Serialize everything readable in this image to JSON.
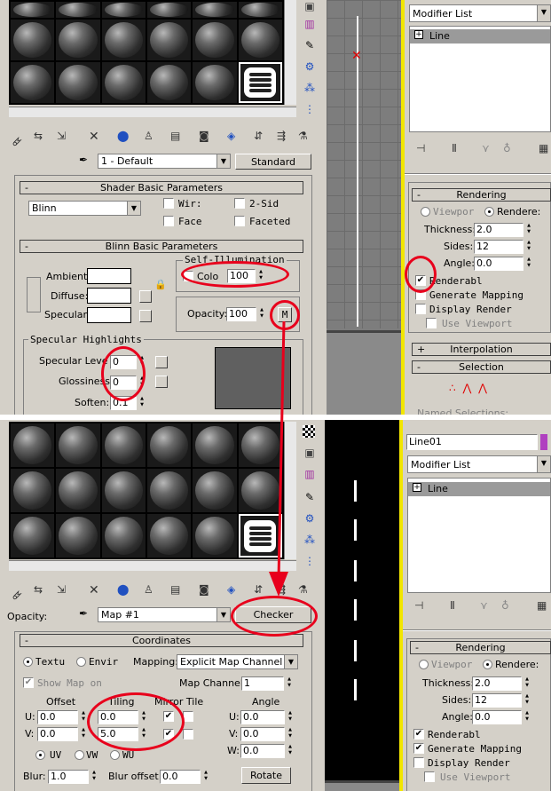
{
  "top": {
    "material_name": "1 - Default",
    "material_type": "Standard",
    "shader_basic": {
      "header": "Shader Basic Parameters",
      "shader": "Blinn",
      "wire": "Wir:",
      "two_sided": "2-Sid",
      "face": "Face",
      "faceted": "Faceted"
    },
    "blinn_basic": {
      "header": "Blinn Basic Parameters",
      "ambient": "Ambient:",
      "diffuse": "Diffuse:",
      "specular": "Specular:",
      "self_illum_title": "Self-Illumination",
      "color": "Colo",
      "color_value": "100",
      "opacity_label": "Opacity:",
      "opacity_value": "100",
      "map_button": "M"
    },
    "spec_highlights": {
      "title": "Specular Highlights",
      "specular_level": "Specular Leve",
      "specular_level_value": "0",
      "glossiness": "Glossiness:",
      "glossiness_value": "0",
      "soften": "Soften:",
      "soften_value": "0.1"
    }
  },
  "top_modify": {
    "modifier_list": "Modifier List",
    "stack_item": "Line",
    "rendering_header": "Rendering",
    "viewport": "Viewpor",
    "renderer": "Rendere:",
    "thickness_label": "Thickness:",
    "thickness": "2.0",
    "sides_label": "Sides:",
    "sides": "12",
    "angle_label": "Angle:",
    "angle": "0.0",
    "renderable": "Renderabl",
    "gen_mapping": "Generate Mapping",
    "display_render": "Display Render",
    "use_viewport": "Use Viewport",
    "interpolation": "Interpolation",
    "selection": "Selection",
    "named_selections": "Named Selections:",
    "plus": "+",
    "minus": "-"
  },
  "bottom": {
    "opacity_label": "Opacity:",
    "map_name": "Map #1",
    "map_type": "Checker",
    "coordinates": {
      "header": "Coordinates",
      "texture": "Textu",
      "environ": "Envir",
      "mapping_label": "Mapping:",
      "mapping_value": "Explicit Map Channel",
      "show_map": "Show Map on",
      "map_channel_label": "Map Channel:",
      "map_channel": "1",
      "offset": "Offset",
      "tiling": "Tiling",
      "mirror_tile": "Mirror Tile",
      "angle": "Angle",
      "u_label": "U:",
      "v_label": "V:",
      "w_label": "W:",
      "offset_u": "0.0",
      "offset_v": "0.0",
      "tiling_u": "0.0",
      "tiling_v": "5.0",
      "angle_u": "0.0",
      "angle_v": "0.0",
      "angle_w": "0.0",
      "uv": "UV",
      "vw": "VW",
      "wu": "WU",
      "blur_label": "Blur:",
      "blur": "1.0",
      "blur_offset_label": "Blur offset:",
      "blur_offset": "0.0",
      "rotate": "Rotate"
    }
  },
  "bottom_modify": {
    "object_name": "Line01",
    "modifier_list": "Modifier List",
    "stack_item": "Line",
    "rendering_header": "Rendering",
    "viewport": "Viewpor",
    "renderer": "Rendere:",
    "thickness_label": "Thickness:",
    "thickness": "2.0",
    "sides_label": "Sides:",
    "sides": "12",
    "angle_label": "Angle:",
    "angle": "0.0",
    "renderable": "Renderabl",
    "gen_mapping": "Generate Mapping",
    "display_render": "Display Render",
    "use_viewport": "Use Viewport",
    "minus": "-"
  },
  "colors": {
    "annotation": "#e8001c",
    "panel": "#d4d0c8",
    "selection_yellow": "#f2e600"
  }
}
